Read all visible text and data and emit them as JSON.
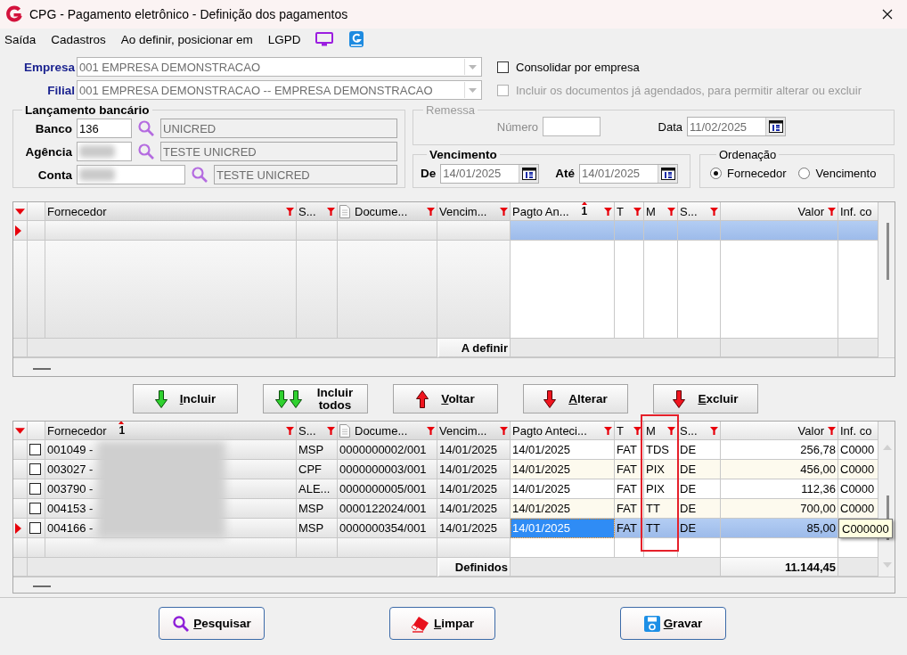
{
  "window": {
    "title": "CPG - Pagamento eletrônico - Definição dos pagamentos"
  },
  "menu": [
    {
      "kind": "text",
      "label": "Saída"
    },
    {
      "kind": "text",
      "label": "Cadastros"
    },
    {
      "kind": "text",
      "label": "Ao definir, posicionar em"
    },
    {
      "kind": "text",
      "label": "LGPD"
    },
    {
      "kind": "monitor"
    },
    {
      "kind": "guide"
    }
  ],
  "empresa": {
    "label": "Empresa",
    "value": "001 EMPRESA DEMONSTRACAO"
  },
  "filial": {
    "label": "Filial",
    "value": "001 EMPRESA DEMONSTRACAO -- EMPRESA DEMONSTRACAO"
  },
  "options": [
    {
      "label": "Consolidar por empresa",
      "checked": false,
      "disabled": false
    },
    {
      "label": "Incluir os documentos já agendados, para permitir alterar ou excluir",
      "checked": false,
      "disabled": true
    }
  ],
  "lancamento": {
    "title": "Lançamento bancário",
    "fields": [
      {
        "label": "Banco",
        "kind": "code",
        "value": "136",
        "redacted": false,
        "description": "UNICRED"
      },
      {
        "label": "Agência",
        "kind": "code",
        "redacted": true,
        "description": "TESTE UNICRED"
      },
      {
        "label": "Conta",
        "kind": "account",
        "redacted": true,
        "description": "TESTE UNICRED"
      }
    ]
  },
  "remessa": {
    "title": "Remessa",
    "disabled": true,
    "numero_label": "Número",
    "data_label": "Data",
    "data": "11/02/2025"
  },
  "vencimento": {
    "title": "Vencimento",
    "de_label": "De",
    "de": "14/01/2025",
    "ate_label": "Até",
    "ate": "14/01/2025"
  },
  "ordenacao": {
    "title": "Ordenação",
    "options": [
      {
        "label": "Fornecedor",
        "selected": true
      },
      {
        "label": "Vencimento",
        "selected": false
      }
    ]
  },
  "grids": [
    {
      "focused": false,
      "columns": [
        {
          "label": "Fornecedor",
          "kind": "text",
          "fixed": true,
          "filter": true,
          "highlighted": false
        },
        {
          "label": "S...",
          "kind": "text",
          "fixed": true,
          "filter": true,
          "highlighted": false
        },
        {
          "label": "Docume...",
          "kind": "document",
          "fixed": true,
          "filter": true,
          "highlighted": false
        },
        {
          "label": "Vencim...",
          "kind": "text",
          "fixed": true,
          "filter": true,
          "highlighted": false
        },
        {
          "label": "Pagto An...",
          "kind": "text",
          "fixed": false,
          "filter": true,
          "highlighted": false,
          "sort": "1"
        },
        {
          "label": "T",
          "kind": "text",
          "fixed": false,
          "filter": true,
          "highlighted": false
        },
        {
          "label": "M",
          "kind": "text",
          "fixed": false,
          "filter": true,
          "highlighted": false
        },
        {
          "label": "S...",
          "kind": "text",
          "fixed": false,
          "filter": true,
          "highlighted": false
        },
        {
          "label": "Valor",
          "kind": "number",
          "fixed": false,
          "filter": true,
          "highlighted": false
        },
        {
          "label": "Inf. co",
          "kind": "text",
          "fixed": false,
          "filter": false,
          "highlighted": false
        }
      ],
      "rows": [
        {
          "selected": true
        }
      ],
      "footer": {
        "label": "A definir"
      }
    },
    {
      "focused": true,
      "tooltip": "C000000",
      "columns": [
        {
          "label": "Fornecedor",
          "kind": "text",
          "fixed": true,
          "filter": true,
          "highlighted": false,
          "sort": "1"
        },
        {
          "label": "S...",
          "kind": "text",
          "fixed": true,
          "filter": true,
          "highlighted": false
        },
        {
          "label": "Docume...",
          "kind": "document",
          "fixed": true,
          "filter": true,
          "highlighted": false
        },
        {
          "label": "Vencim...",
          "kind": "text",
          "fixed": true,
          "filter": true,
          "highlighted": false
        },
        {
          "label": "Pagto Anteci...",
          "kind": "text",
          "fixed": false,
          "filter": true,
          "highlighted": false
        },
        {
          "label": "T",
          "kind": "text",
          "fixed": false,
          "filter": true,
          "highlighted": false
        },
        {
          "label": "M",
          "kind": "text",
          "fixed": false,
          "filter": true,
          "highlighted": true
        },
        {
          "label": "S...",
          "kind": "text",
          "fixed": false,
          "filter": true,
          "highlighted": false
        },
        {
          "label": "Valor",
          "kind": "number",
          "fixed": false,
          "filter": true,
          "highlighted": false
        },
        {
          "label": "Inf. co",
          "kind": "text",
          "fixed": false,
          "filter": false,
          "highlighted": false
        }
      ],
      "rows": [
        {
          "selected": false,
          "checked": false,
          "name_redacted": true,
          "cells": [
            "001049 -",
            "MSP",
            "0000000002/001",
            "14/01/2025",
            "14/01/2025",
            "FAT",
            "TDS",
            "DE",
            "256,78",
            "C0000"
          ]
        },
        {
          "selected": false,
          "checked": false,
          "name_redacted": true,
          "cells": [
            "003027 -",
            "CPF",
            "0000000003/001",
            "14/01/2025",
            "14/01/2025",
            "FAT",
            "PIX",
            "DE",
            "456,00",
            "C0000"
          ]
        },
        {
          "selected": false,
          "checked": false,
          "name_redacted": true,
          "cells": [
            "003790 -",
            "ALE...",
            "0000000005/001",
            "14/01/2025",
            "14/01/2025",
            "FAT",
            "PIX",
            "DE",
            "112,36",
            "C0000"
          ]
        },
        {
          "selected": false,
          "checked": false,
          "name_redacted": true,
          "cells": [
            "004153 -",
            "MSP",
            "0000122024/001",
            "14/01/2025",
            "14/01/2025",
            "FAT",
            "TT",
            "DE",
            "700,00",
            "C0000"
          ]
        },
        {
          "selected": true,
          "checked": false,
          "name_redacted": true,
          "cells": [
            "004166 -",
            "MSP",
            "0000000354/001",
            "14/01/2025",
            "14/01/2025",
            "FAT",
            "TT",
            "DE",
            "85,00"
          ]
        }
      ],
      "footer": {
        "label": "Definidos",
        "total": "11.144,45"
      }
    }
  ],
  "buttons": [
    {
      "label": "Incluir",
      "kind": "down-green",
      "mnemonic": true
    },
    {
      "label": "Incluir todos",
      "kind": "double-down-green",
      "mnemonic": false
    },
    {
      "label": "Voltar",
      "kind": "up-red",
      "mnemonic": true
    },
    {
      "label": "Alterar",
      "kind": "down-red",
      "mnemonic": true
    },
    {
      "label": "Excluir",
      "kind": "down-red",
      "mnemonic": true
    }
  ],
  "actions": [
    {
      "label": "Pesquisar",
      "kind": "search"
    },
    {
      "label": "Limpar",
      "kind": "eraser"
    },
    {
      "label": "Gravar",
      "kind": "save"
    }
  ]
}
